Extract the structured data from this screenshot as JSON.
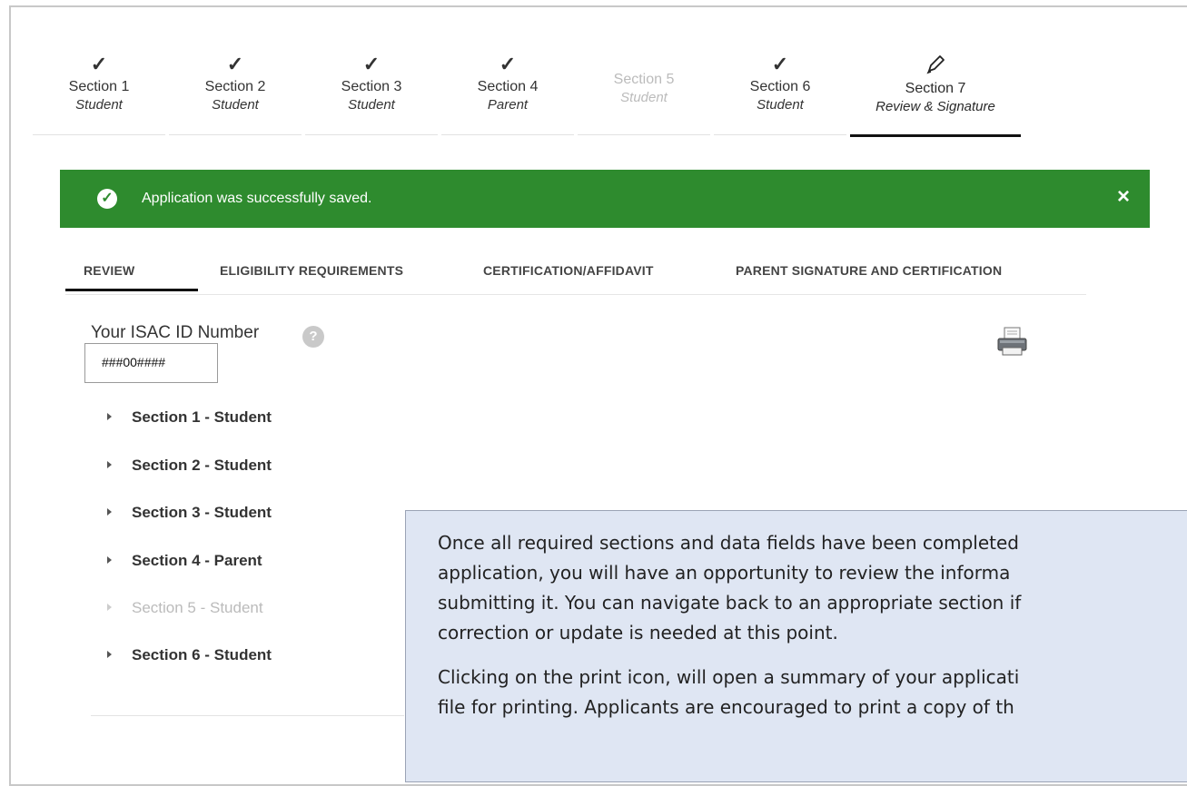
{
  "steps": [
    {
      "label": "Section 1",
      "sub": "Student",
      "status": "complete",
      "mark": "✓"
    },
    {
      "label": "Section 2",
      "sub": "Student",
      "status": "complete",
      "mark": "✓"
    },
    {
      "label": "Section 3",
      "sub": "Student",
      "status": "complete",
      "mark": "✓"
    },
    {
      "label": "Section 4",
      "sub": "Parent",
      "status": "complete",
      "mark": "✓"
    },
    {
      "label": "Section 5",
      "sub": "Student",
      "status": "disabled",
      "mark": ""
    },
    {
      "label": "Section 6",
      "sub": "Student",
      "status": "complete",
      "mark": "✓"
    },
    {
      "label": "Section 7",
      "sub": "Review & Signature",
      "status": "active",
      "icon": "pencil-icon"
    }
  ],
  "alert": {
    "message": "Application was successfully saved.",
    "close": "×",
    "icon": "check-circle-icon",
    "color": "#2e8b2e"
  },
  "tabs": [
    {
      "label": "REVIEW",
      "active": true
    },
    {
      "label": "ELIGIBILITY REQUIREMENTS",
      "active": false
    },
    {
      "label": "CERTIFICATION/AFFIDAVIT",
      "active": false
    },
    {
      "label": "PARENT SIGNATURE AND CERTIFICATION",
      "active": false
    }
  ],
  "isac": {
    "label": "Your ISAC ID Number",
    "help": "?",
    "value": "###00####"
  },
  "print_icon": "printer-icon",
  "sections": [
    {
      "label": "Section 1 - Student",
      "disabled": false
    },
    {
      "label": "Section 2 - Student",
      "disabled": false
    },
    {
      "label": "Section 3 - Student",
      "disabled": false
    },
    {
      "label": "Section 4 - Parent",
      "disabled": false
    },
    {
      "label": "Section 5 - Student",
      "disabled": true
    },
    {
      "label": "Section 6 - Student",
      "disabled": false
    }
  ],
  "callout": {
    "lines": [
      "Once all required sections and data fields have been completed",
      "application,  you will have an opportunity to review the informa",
      "submitting it. You can navigate back to an appropriate section if",
      "correction or update is needed at this point.",
      "Clicking on the print icon, will open a summary of your applicati",
      "file for printing.  Applicants are encouraged to print a copy of th"
    ],
    "background": "#dfe6f3"
  }
}
